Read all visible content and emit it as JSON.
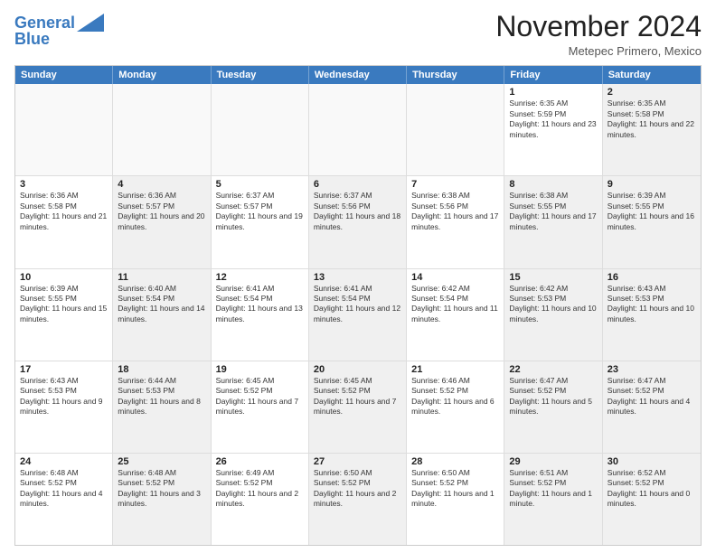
{
  "logo": {
    "line1": "General",
    "line2": "Blue"
  },
  "title": "November 2024",
  "subtitle": "Metepec Primero, Mexico",
  "header": {
    "days": [
      "Sunday",
      "Monday",
      "Tuesday",
      "Wednesday",
      "Thursday",
      "Friday",
      "Saturday"
    ]
  },
  "weeks": [
    {
      "cells": [
        {
          "day": "",
          "info": "",
          "empty": true
        },
        {
          "day": "",
          "info": "",
          "empty": true
        },
        {
          "day": "",
          "info": "",
          "empty": true
        },
        {
          "day": "",
          "info": "",
          "empty": true
        },
        {
          "day": "",
          "info": "",
          "empty": true
        },
        {
          "day": "1",
          "info": "Sunrise: 6:35 AM\nSunset: 5:59 PM\nDaylight: 11 hours and 23 minutes."
        },
        {
          "day": "2",
          "info": "Sunrise: 6:35 AM\nSunset: 5:58 PM\nDaylight: 11 hours and 22 minutes.",
          "shaded": true
        }
      ]
    },
    {
      "cells": [
        {
          "day": "3",
          "info": "Sunrise: 6:36 AM\nSunset: 5:58 PM\nDaylight: 11 hours and 21 minutes."
        },
        {
          "day": "4",
          "info": "Sunrise: 6:36 AM\nSunset: 5:57 PM\nDaylight: 11 hours and 20 minutes.",
          "shaded": true
        },
        {
          "day": "5",
          "info": "Sunrise: 6:37 AM\nSunset: 5:57 PM\nDaylight: 11 hours and 19 minutes."
        },
        {
          "day": "6",
          "info": "Sunrise: 6:37 AM\nSunset: 5:56 PM\nDaylight: 11 hours and 18 minutes.",
          "shaded": true
        },
        {
          "day": "7",
          "info": "Sunrise: 6:38 AM\nSunset: 5:56 PM\nDaylight: 11 hours and 17 minutes."
        },
        {
          "day": "8",
          "info": "Sunrise: 6:38 AM\nSunset: 5:55 PM\nDaylight: 11 hours and 17 minutes.",
          "shaded": true
        },
        {
          "day": "9",
          "info": "Sunrise: 6:39 AM\nSunset: 5:55 PM\nDaylight: 11 hours and 16 minutes.",
          "shaded": true
        }
      ]
    },
    {
      "cells": [
        {
          "day": "10",
          "info": "Sunrise: 6:39 AM\nSunset: 5:55 PM\nDaylight: 11 hours and 15 minutes."
        },
        {
          "day": "11",
          "info": "Sunrise: 6:40 AM\nSunset: 5:54 PM\nDaylight: 11 hours and 14 minutes.",
          "shaded": true
        },
        {
          "day": "12",
          "info": "Sunrise: 6:41 AM\nSunset: 5:54 PM\nDaylight: 11 hours and 13 minutes."
        },
        {
          "day": "13",
          "info": "Sunrise: 6:41 AM\nSunset: 5:54 PM\nDaylight: 11 hours and 12 minutes.",
          "shaded": true
        },
        {
          "day": "14",
          "info": "Sunrise: 6:42 AM\nSunset: 5:54 PM\nDaylight: 11 hours and 11 minutes."
        },
        {
          "day": "15",
          "info": "Sunrise: 6:42 AM\nSunset: 5:53 PM\nDaylight: 11 hours and 10 minutes.",
          "shaded": true
        },
        {
          "day": "16",
          "info": "Sunrise: 6:43 AM\nSunset: 5:53 PM\nDaylight: 11 hours and 10 minutes.",
          "shaded": true
        }
      ]
    },
    {
      "cells": [
        {
          "day": "17",
          "info": "Sunrise: 6:43 AM\nSunset: 5:53 PM\nDaylight: 11 hours and 9 minutes."
        },
        {
          "day": "18",
          "info": "Sunrise: 6:44 AM\nSunset: 5:53 PM\nDaylight: 11 hours and 8 minutes.",
          "shaded": true
        },
        {
          "day": "19",
          "info": "Sunrise: 6:45 AM\nSunset: 5:52 PM\nDaylight: 11 hours and 7 minutes."
        },
        {
          "day": "20",
          "info": "Sunrise: 6:45 AM\nSunset: 5:52 PM\nDaylight: 11 hours and 7 minutes.",
          "shaded": true
        },
        {
          "day": "21",
          "info": "Sunrise: 6:46 AM\nSunset: 5:52 PM\nDaylight: 11 hours and 6 minutes."
        },
        {
          "day": "22",
          "info": "Sunrise: 6:47 AM\nSunset: 5:52 PM\nDaylight: 11 hours and 5 minutes.",
          "shaded": true
        },
        {
          "day": "23",
          "info": "Sunrise: 6:47 AM\nSunset: 5:52 PM\nDaylight: 11 hours and 4 minutes.",
          "shaded": true
        }
      ]
    },
    {
      "cells": [
        {
          "day": "24",
          "info": "Sunrise: 6:48 AM\nSunset: 5:52 PM\nDaylight: 11 hours and 4 minutes."
        },
        {
          "day": "25",
          "info": "Sunrise: 6:48 AM\nSunset: 5:52 PM\nDaylight: 11 hours and 3 minutes.",
          "shaded": true
        },
        {
          "day": "26",
          "info": "Sunrise: 6:49 AM\nSunset: 5:52 PM\nDaylight: 11 hours and 2 minutes."
        },
        {
          "day": "27",
          "info": "Sunrise: 6:50 AM\nSunset: 5:52 PM\nDaylight: 11 hours and 2 minutes.",
          "shaded": true
        },
        {
          "day": "28",
          "info": "Sunrise: 6:50 AM\nSunset: 5:52 PM\nDaylight: 11 hours and 1 minute."
        },
        {
          "day": "29",
          "info": "Sunrise: 6:51 AM\nSunset: 5:52 PM\nDaylight: 11 hours and 1 minute.",
          "shaded": true
        },
        {
          "day": "30",
          "info": "Sunrise: 6:52 AM\nSunset: 5:52 PM\nDaylight: 11 hours and 0 minutes.",
          "shaded": true
        }
      ]
    }
  ]
}
